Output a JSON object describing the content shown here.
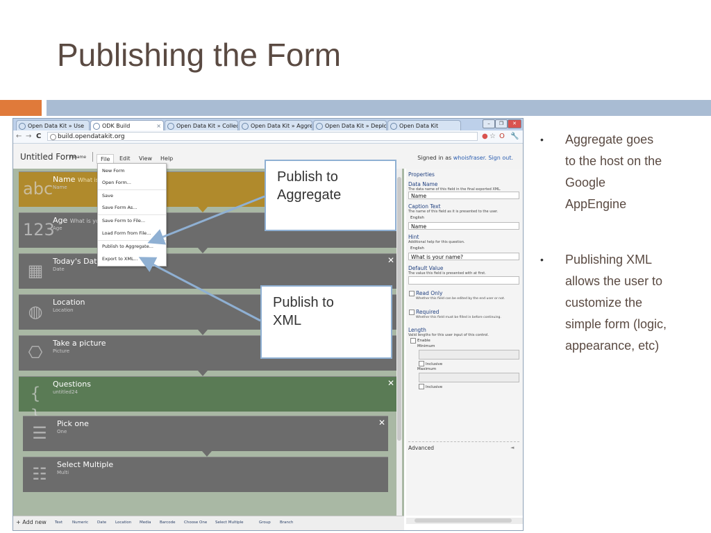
{
  "slide": {
    "title": "Publishing the Form",
    "colors": {
      "title": "#5a4a42",
      "band_orange": "#e07a3a",
      "band_blue": "#a9bcd3",
      "callout_border": "#8fb0d3",
      "arrow": "#8fb0d3"
    }
  },
  "browser": {
    "tabs": [
      {
        "label": "Open Data Kit » Use"
      },
      {
        "label": "ODK Build"
      },
      {
        "label": "Open Data Kit » Collect"
      },
      {
        "label": "Open Data Kit » Aggregate"
      },
      {
        "label": "Open Data Kit » Deployme"
      },
      {
        "label": "Open Data Kit"
      }
    ],
    "url": "build.opendatakit.org"
  },
  "app": {
    "form_title": "Untitled Form",
    "rename_label": "rename",
    "menus": [
      "File",
      "Edit",
      "View",
      "Help"
    ],
    "signed_in_prefix": "Signed in as",
    "username": "whoisfraser.",
    "sign_out": "Sign out."
  },
  "file_menu": [
    "New Form",
    "Open Form...",
    "Save",
    "Save Form As...",
    "Save Form to File...",
    "Load Form from File...",
    "Publish to Aggregate...",
    "Export to XML..."
  ],
  "controls": [
    {
      "name": "Name",
      "suffix": "What is y",
      "sub": "Name",
      "icon": "abc-text-icon"
    },
    {
      "name": "Age",
      "suffix": "What is you",
      "sub": "Age",
      "icon": "numeric-123-icon"
    },
    {
      "name": "Today's Date",
      "sub": "Date",
      "icon": "calendar-icon"
    },
    {
      "name": "Location",
      "sub": "Location",
      "icon": "globe-icon"
    },
    {
      "name": "Take a picture",
      "sub": "Picture",
      "icon": "camera-icon"
    },
    {
      "name": "Questions",
      "sub": "untitled24",
      "icon": "braces-group-icon"
    },
    {
      "name": "Pick one",
      "sub": "One",
      "icon": "choose-one-icon"
    },
    {
      "name": "Select Multiple",
      "sub": "Multi",
      "icon": "select-multiple-icon"
    }
  ],
  "properties": {
    "heading": "Properties",
    "data_name": {
      "label": "Data Name",
      "desc": "The data name of this field in the final exported XML.",
      "value": "Name"
    },
    "caption": {
      "label": "Caption Text",
      "desc": "The name of this field as it is presented to the user.",
      "lang": "English",
      "value": "Name"
    },
    "hint": {
      "label": "Hint",
      "desc": "Additional help for this question.",
      "lang": "English",
      "value": "What is your name?"
    },
    "default": {
      "label": "Default Value",
      "desc": "The value this field is presented with at first."
    },
    "read_only": {
      "label": "Read Only",
      "desc": "Whether this field can be edited by the end user or not."
    },
    "required": {
      "label": "Required",
      "desc": "Whether this field must be filled in before continuing."
    },
    "length": {
      "label": "Length",
      "desc": "Valid lengths for this user input of this control.",
      "enable": "Enable",
      "minimum": "Minimum",
      "maximum": "Maximum",
      "inclusive": "Inclusive"
    },
    "advanced": "Advanced"
  },
  "add_bar": {
    "add_new": "Add new",
    "items": [
      "Text",
      "Numeric",
      "Date",
      "Location",
      "Media",
      "Barcode",
      "Choose One",
      "Select Multiple",
      "Group",
      "Branch"
    ]
  },
  "callouts": {
    "aggregate": [
      "Publish to",
      "Aggregate"
    ],
    "xml": [
      "Publish to",
      "XML"
    ]
  },
  "bullets": [
    [
      "Aggregate goes",
      "to the host on the",
      "Google",
      "AppEngine"
    ],
    [
      "Publishing XML",
      "allows the user to",
      "customize the",
      "simple form (logic,",
      "appearance, etc)"
    ]
  ]
}
